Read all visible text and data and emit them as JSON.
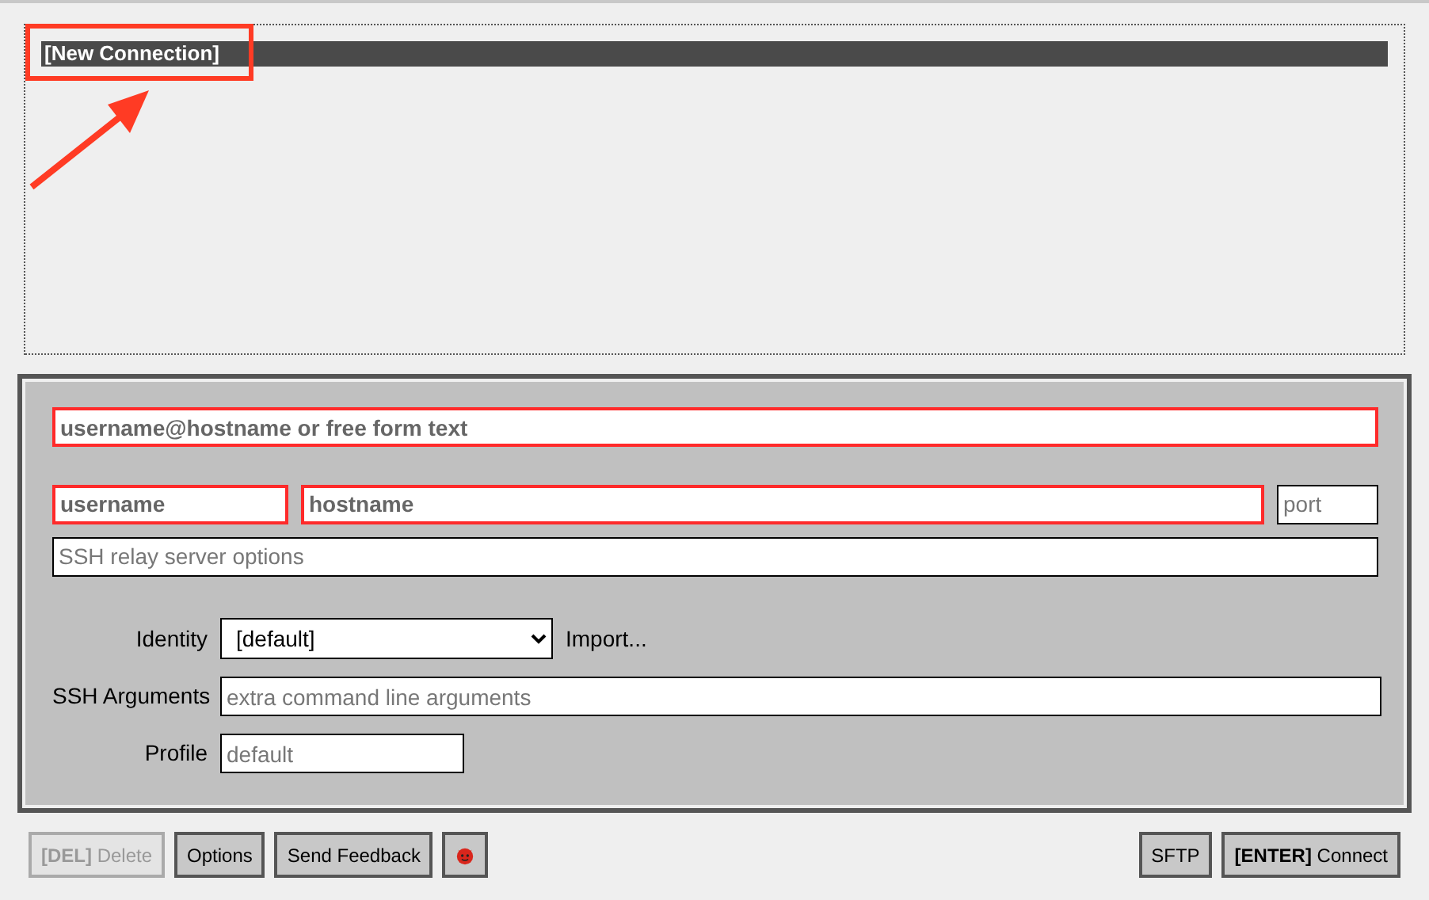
{
  "connections": [
    {
      "label": "[New Connection]",
      "selected": true
    }
  ],
  "form": {
    "quick": {
      "placeholder": "username@hostname or free form text",
      "invalid": true
    },
    "user": {
      "placeholder": "username",
      "invalid": true
    },
    "host": {
      "placeholder": "hostname",
      "invalid": true
    },
    "port": {
      "placeholder": "port",
      "invalid": false
    },
    "relay": {
      "placeholder": "SSH relay server options",
      "invalid": false
    },
    "identity": {
      "label": "Identity",
      "value": "[default]",
      "link": "Import..."
    },
    "arguments": {
      "label": "SSH Arguments",
      "placeholder": "extra command line arguments"
    },
    "profile": {
      "label": "Profile",
      "placeholder": "default"
    }
  },
  "buttons_left": [
    {
      "kind": "text",
      "label": "**[DEL]** Delete",
      "disabled": true
    },
    {
      "kind": "text",
      "label": "Options",
      "disabled": false
    },
    {
      "kind": "text",
      "label": "Send Feedback",
      "disabled": false
    },
    {
      "kind": "icon",
      "disabled": false
    }
  ],
  "buttons_right": [
    {
      "kind": "text",
      "label": "SFTP",
      "disabled": false
    },
    {
      "kind": "text",
      "label": "**[ENTER]** Connect",
      "disabled": false
    }
  ]
}
